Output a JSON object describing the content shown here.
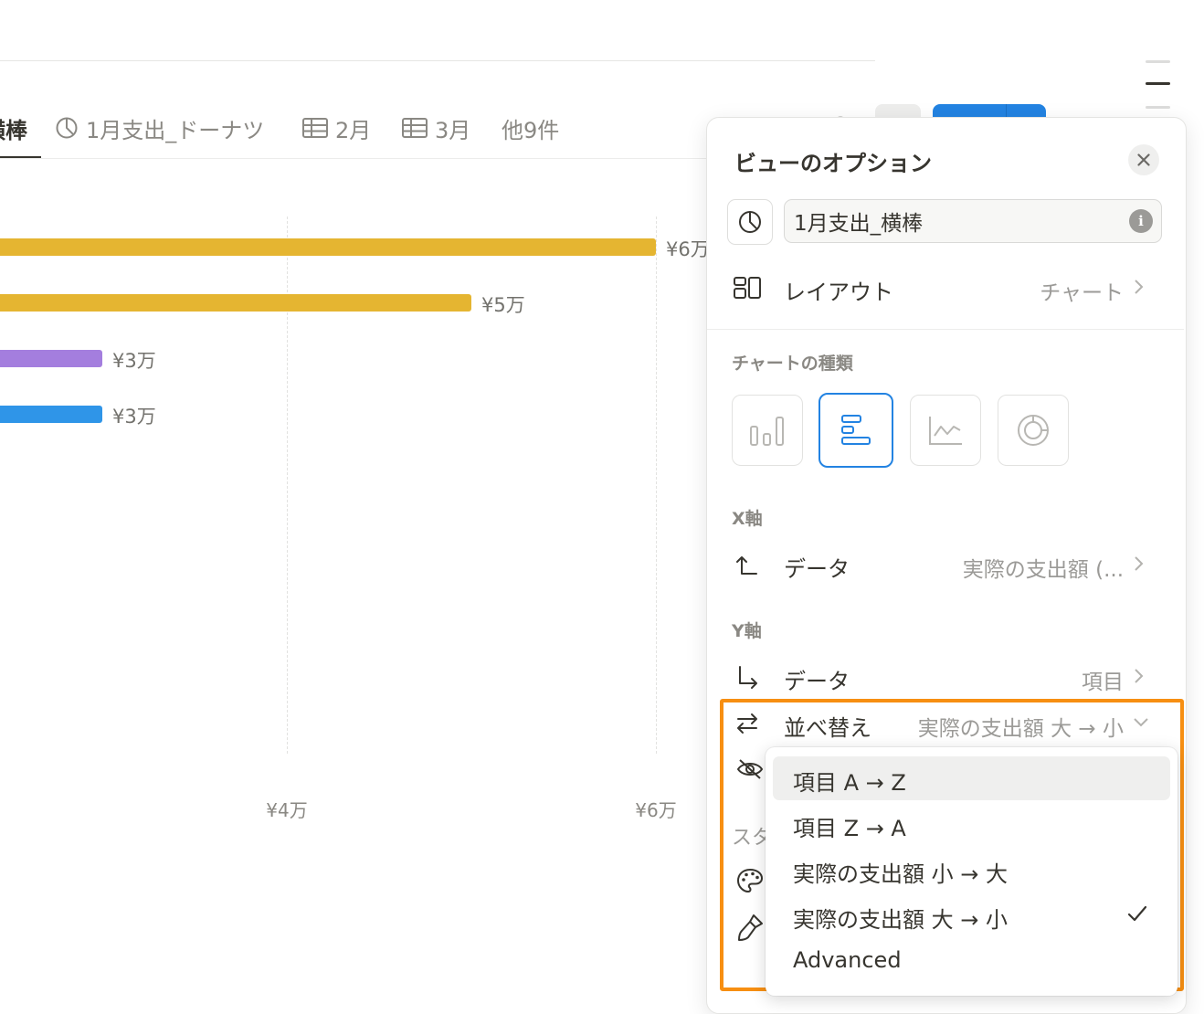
{
  "tabs": [
    {
      "label": "横棒",
      "icon": "bar-chart-horizontal-icon",
      "active": true
    },
    {
      "label": "1月支出_ドーナツ",
      "icon": "pie-chart-icon"
    },
    {
      "label": "2月",
      "icon": "table-icon"
    },
    {
      "label": "3月",
      "icon": "table-icon"
    },
    {
      "label": "他9件"
    }
  ],
  "chart_data": {
    "type": "bar",
    "orientation": "horizontal",
    "values": [
      60000,
      50000,
      30000,
      30000
    ],
    "value_labels": [
      "¥6万",
      "¥5万",
      "¥3万",
      "¥3万"
    ],
    "bar_colors": [
      "#e5b531",
      "#e5b531",
      "#a47ede",
      "#2f95e8"
    ],
    "x_ticks": [
      {
        "value": 40000,
        "label": "¥4万"
      },
      {
        "value": 60000,
        "label": "¥6万"
      }
    ],
    "grid": true
  },
  "panel": {
    "title": "ビューのオプション",
    "view_name": "1月支出_横棒",
    "layout": {
      "label": "レイアウト",
      "value": "チャート"
    },
    "chart_type_section": "チャートの種類",
    "chart_types": [
      {
        "icon": "vertical-bar-chart-icon",
        "selected": false
      },
      {
        "icon": "horizontal-bar-chart-icon",
        "selected": true
      },
      {
        "icon": "line-chart-icon",
        "selected": false
      },
      {
        "icon": "donut-chart-icon",
        "selected": false
      }
    ],
    "x_axis": {
      "section": "X軸",
      "label": "データ",
      "value": "実際の支出額 (..."
    },
    "y_axis": {
      "section": "Y軸",
      "label": "データ",
      "value": "項目"
    },
    "sort": {
      "label": "並べ替え",
      "value": "実際の支出額 大 → 小"
    },
    "style_section_partial": "スタ"
  },
  "sort_dropdown": {
    "options": [
      {
        "label": "項目 A → Z",
        "hover": true,
        "checked": false
      },
      {
        "label": "項目 Z → A",
        "hover": false,
        "checked": false
      },
      {
        "label": "実際の支出額 小 → 大",
        "hover": false,
        "checked": false
      },
      {
        "label": "実際の支出額 大 → 小",
        "hover": false,
        "checked": true
      },
      {
        "label": "Advanced",
        "hover": false,
        "checked": false
      }
    ]
  },
  "colors": {
    "accent": "#2383e2",
    "highlight": "#f78f12",
    "text": "#37352f",
    "muted": "#9b9a97"
  }
}
